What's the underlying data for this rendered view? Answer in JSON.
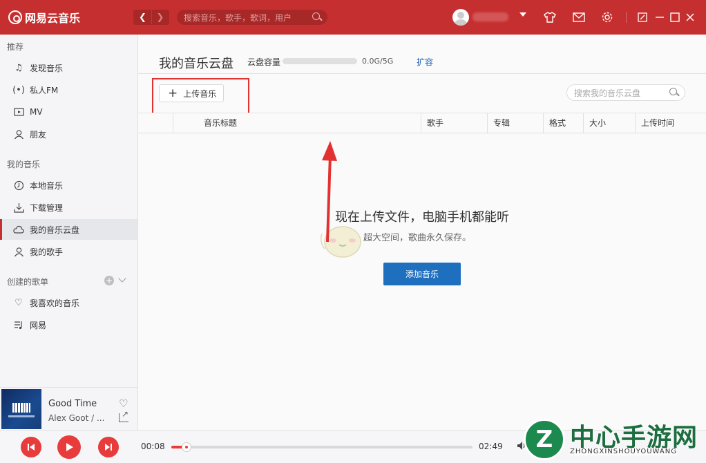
{
  "app": {
    "logo_text": "网易云音乐",
    "search_placeholder": "搜索音乐，歌手，歌词，用户"
  },
  "sidebar": {
    "sections": [
      {
        "title": "推荐",
        "items": [
          {
            "label": "发现音乐",
            "icon": "music-note-icon"
          },
          {
            "label": "私人FM",
            "icon": "radio-icon"
          },
          {
            "label": "MV",
            "icon": "video-icon"
          },
          {
            "label": "朋友",
            "icon": "friends-icon"
          }
        ]
      },
      {
        "title": "我的音乐",
        "items": [
          {
            "label": "本地音乐",
            "icon": "local-music-icon"
          },
          {
            "label": "下载管理",
            "icon": "download-icon"
          },
          {
            "label": "我的音乐云盘",
            "icon": "cloud-icon",
            "active": true
          },
          {
            "label": "我的歌手",
            "icon": "singer-icon"
          }
        ]
      },
      {
        "title": "创建的歌单",
        "items": [
          {
            "label": "我喜欢的音乐",
            "icon": "heart-icon"
          },
          {
            "label": "网易",
            "icon": "playlist-icon"
          }
        ]
      }
    ]
  },
  "now_playing": {
    "title": "Good Time",
    "artist": "Alex Goot / ..."
  },
  "main": {
    "title": "我的音乐云盘",
    "capacity_label": "云盘容量",
    "capacity_value": "0.0G/5G",
    "capacity_fraction": 0.0,
    "expand_label": "扩容",
    "upload_label": "上传音乐",
    "search_placeholder": "搜索我的音乐云盘",
    "columns": [
      "音乐标题",
      "歌手",
      "专辑",
      "格式",
      "大小",
      "上传时间"
    ],
    "empty_title": "现在上传文件，电脑手机都能听",
    "empty_subtitle": "超大空间，歌曲永久保存。",
    "add_button": "添加音乐"
  },
  "player": {
    "current_time": "00:08",
    "total_time": "02:49",
    "progress_fraction": 0.05
  },
  "watermark": {
    "badge": "Z",
    "text": "中心手游网",
    "sub": "ZHONGXINSHOUYOUWANG"
  },
  "colors": {
    "brand_red": "#c62f2f",
    "accent_blue": "#1f6fbf",
    "annotation_red": "#e23131"
  }
}
